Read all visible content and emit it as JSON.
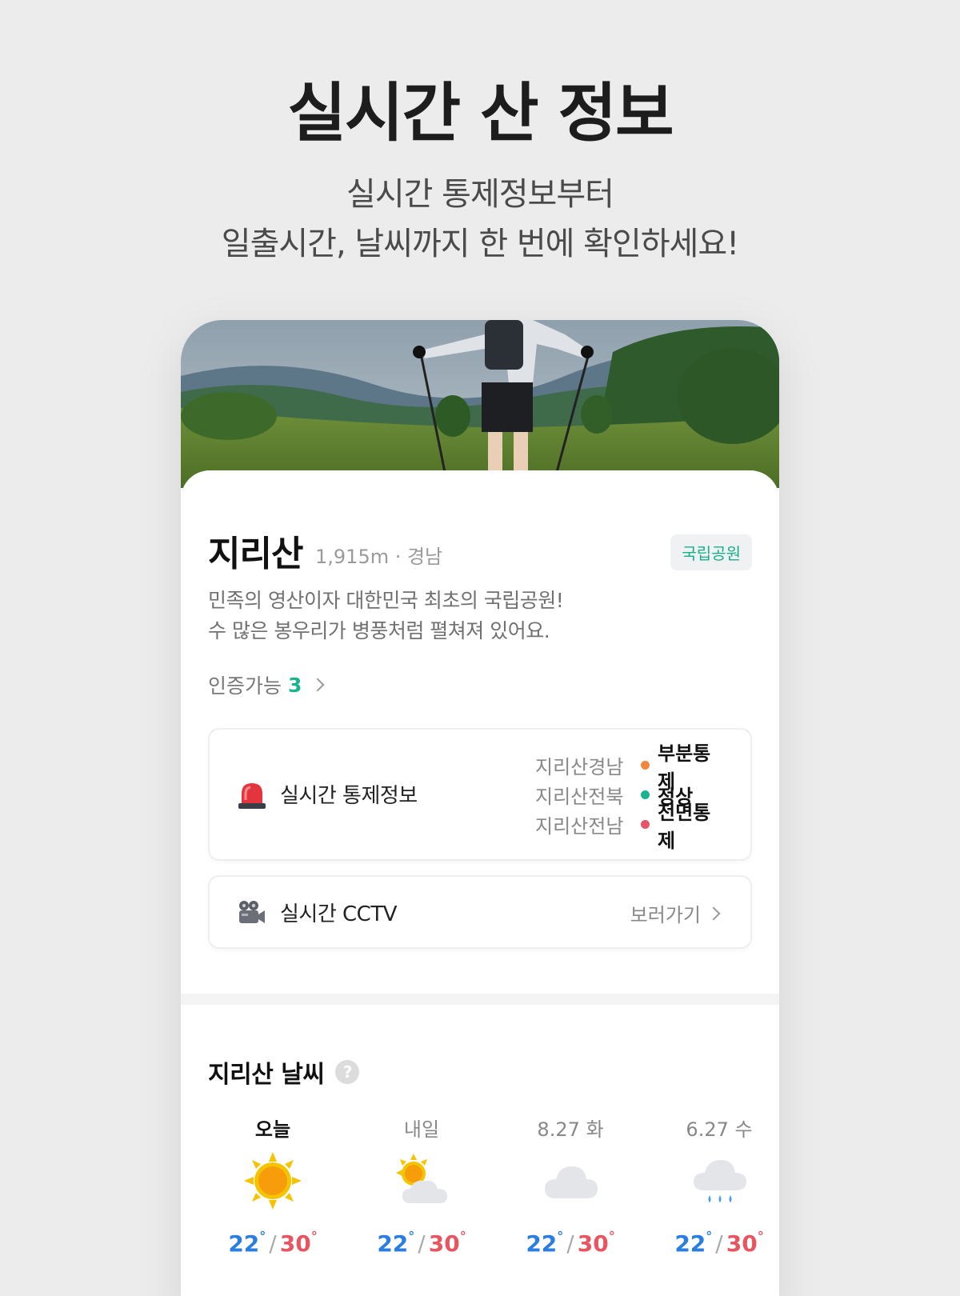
{
  "promo": {
    "headline": "실시간 산 정보",
    "subline_1": "실시간 통제정보부터",
    "subline_2": "일출시간, 날씨까지 한 번에 확인하세요!"
  },
  "mountain": {
    "name": "지리산",
    "meta": "1,915m · 경남",
    "badge": "국립공원",
    "desc_1": "민족의 영산이자 대한민국 최초의 국립공원!",
    "desc_2": "수 많은 봉우리가 병풍처럼 펼쳐져 있어요.",
    "cert_label": "인증가능",
    "cert_count": "3"
  },
  "control": {
    "title": "실시간 통제정보",
    "icon": "siren-icon",
    "items": [
      {
        "region": "지리산경남",
        "state": "부분통제",
        "color": "#f0883b"
      },
      {
        "region": "지리산전북",
        "state": "정상",
        "color": "#19b48f"
      },
      {
        "region": "지리산전남",
        "state": "전면통제",
        "color": "#e5566a"
      }
    ]
  },
  "cctv": {
    "title": "실시간 CCTV",
    "icon": "movie-camera-icon",
    "link": "보러가기"
  },
  "weather": {
    "title": "지리산 날씨",
    "help": "?",
    "days": [
      {
        "label": "오늘",
        "icon": "sun-icon",
        "low": "22",
        "high": "30"
      },
      {
        "label": "내일",
        "icon": "partly-cloudy-icon",
        "low": "22",
        "high": "30"
      },
      {
        "label": "8.27 화",
        "icon": "cloud-icon",
        "low": "22",
        "high": "30"
      },
      {
        "label": "6.27 수",
        "icon": "rain-icon",
        "low": "22",
        "high": "30"
      }
    ],
    "deg_symbol": "°",
    "separator": "/"
  },
  "colors": {
    "accent_green": "#19b48f",
    "low_temp": "#2a7de1",
    "high_temp": "#e8545f"
  }
}
